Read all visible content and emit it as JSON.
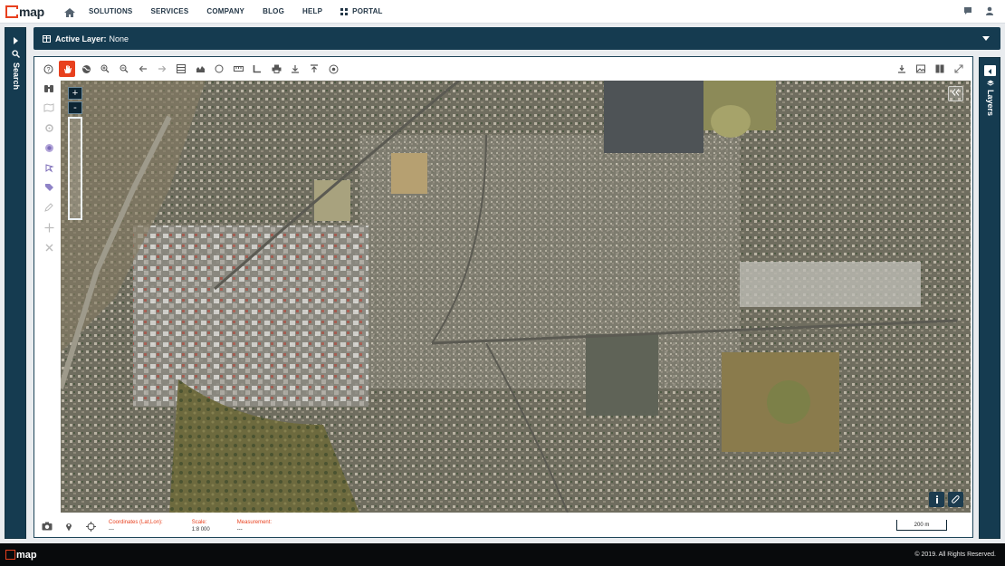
{
  "brand": {
    "logo_text": "map"
  },
  "nav": {
    "items": [
      {
        "label": "SOLUTIONS"
      },
      {
        "label": "SERVICES"
      },
      {
        "label": "COMPANY"
      },
      {
        "label": "BLOG"
      },
      {
        "label": "HELP"
      }
    ],
    "portal_label": "PORTAL"
  },
  "left_panel": {
    "label": "Search"
  },
  "right_panel": {
    "label": "Layers"
  },
  "active_layer": {
    "label": "Active Layer:",
    "value": "None"
  },
  "status": {
    "coordinates_label": "Coordinates (Lat,Lon):",
    "coordinates_value": "---",
    "scale_label": "Scale:",
    "scale_value": "1:8 000",
    "measurement_label": "Measurement:",
    "measurement_value": "---",
    "scalebar_label": "200 m"
  },
  "zoom": {
    "in_label": "+",
    "out_label": "-"
  },
  "footer": {
    "logo_text": "map",
    "copyright": "© 2019. All Rights Reserved."
  },
  "colors": {
    "accent": "#e8401e",
    "panel": "#153b50",
    "footer": "#080a0c"
  }
}
